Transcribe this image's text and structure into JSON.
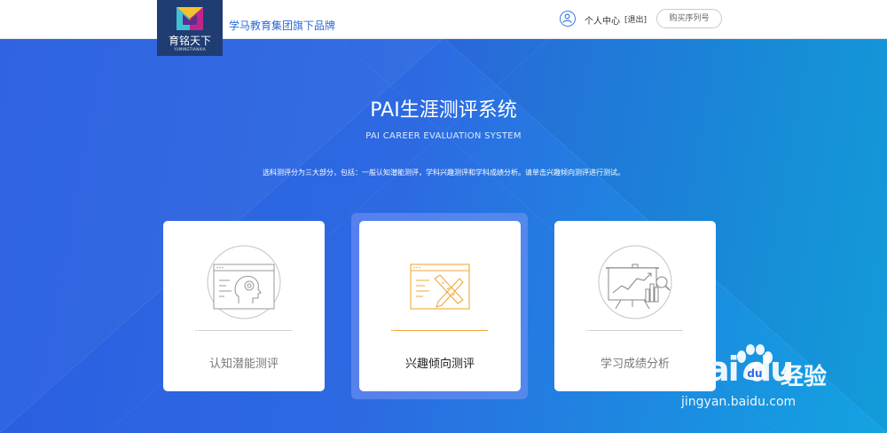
{
  "header": {
    "logo_text": "育铭天下",
    "logo_subtext": "YUMINGTIANXIA",
    "slogan": "学马教育集团旗下品牌",
    "user_center": "个人中心",
    "logout": "[退出]",
    "buy_serial": "购买序列号"
  },
  "hero": {
    "title": "PAI生涯测评系统",
    "subtitle": "PAI CAREER EVALUATION SYSTEM",
    "description": "选科测评分为三大部分，包括：一般认知潜能测评，学科兴趣测评和学科成绩分析。请单击兴趣倾向测评进行测试。"
  },
  "cards": [
    {
      "label": "认知潜能测评",
      "icon": "brain-screen-icon",
      "accent": "#9a9a9a"
    },
    {
      "label": "兴趣倾向测评",
      "icon": "ruler-pencil-screen-icon",
      "accent": "#f0a83a"
    },
    {
      "label": "学习成绩分析",
      "icon": "chart-board-icon",
      "accent": "#9a9a9a"
    }
  ],
  "watermark": {
    "brand": "Bai  du",
    "name": "经验",
    "url": "jingyan.baidu.com"
  },
  "colors": {
    "primary": "#2c6bd6",
    "hero_start": "#2a5ee0",
    "hero_end": "#13a3e2",
    "highlight": "#f0a83a"
  }
}
